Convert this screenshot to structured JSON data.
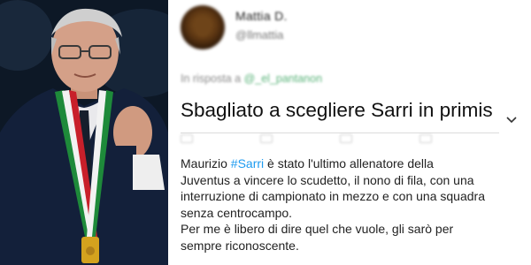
{
  "photo": {
    "subject_description": "",
    "colors": {
      "suit": "#13203a",
      "shirt": "#e9e9ec",
      "ribbon_red": "#c8202a",
      "ribbon_green": "#1e8a3a",
      "medal": "#d4a21e"
    }
  },
  "tweet": {
    "author_name": "Mattia D.",
    "author_handle": "@llmattia",
    "reply_prefix": "In risposta a",
    "reply_mention": "@_el_pantanon",
    "headline": "Sbagliato a scegliere Sarri in primis",
    "body_before_hashtag": "Maurizio ",
    "hashtag": "#Sarri",
    "body_after_hashtag": " è stato l'ultimo allenatore della\nJuventus a vincere lo scudetto, il nono di fila, con una\ninterruzione di campionato in mezzo e con una squadra\nsenza centrocampo.",
    "body_second": "Per me è libero di dire quel che vuole, gli sarò per\nsempre riconoscente.",
    "icons": [
      "chevron-down-icon",
      "reply-icon",
      "retweet-icon",
      "like-icon",
      "share-icon"
    ]
  }
}
